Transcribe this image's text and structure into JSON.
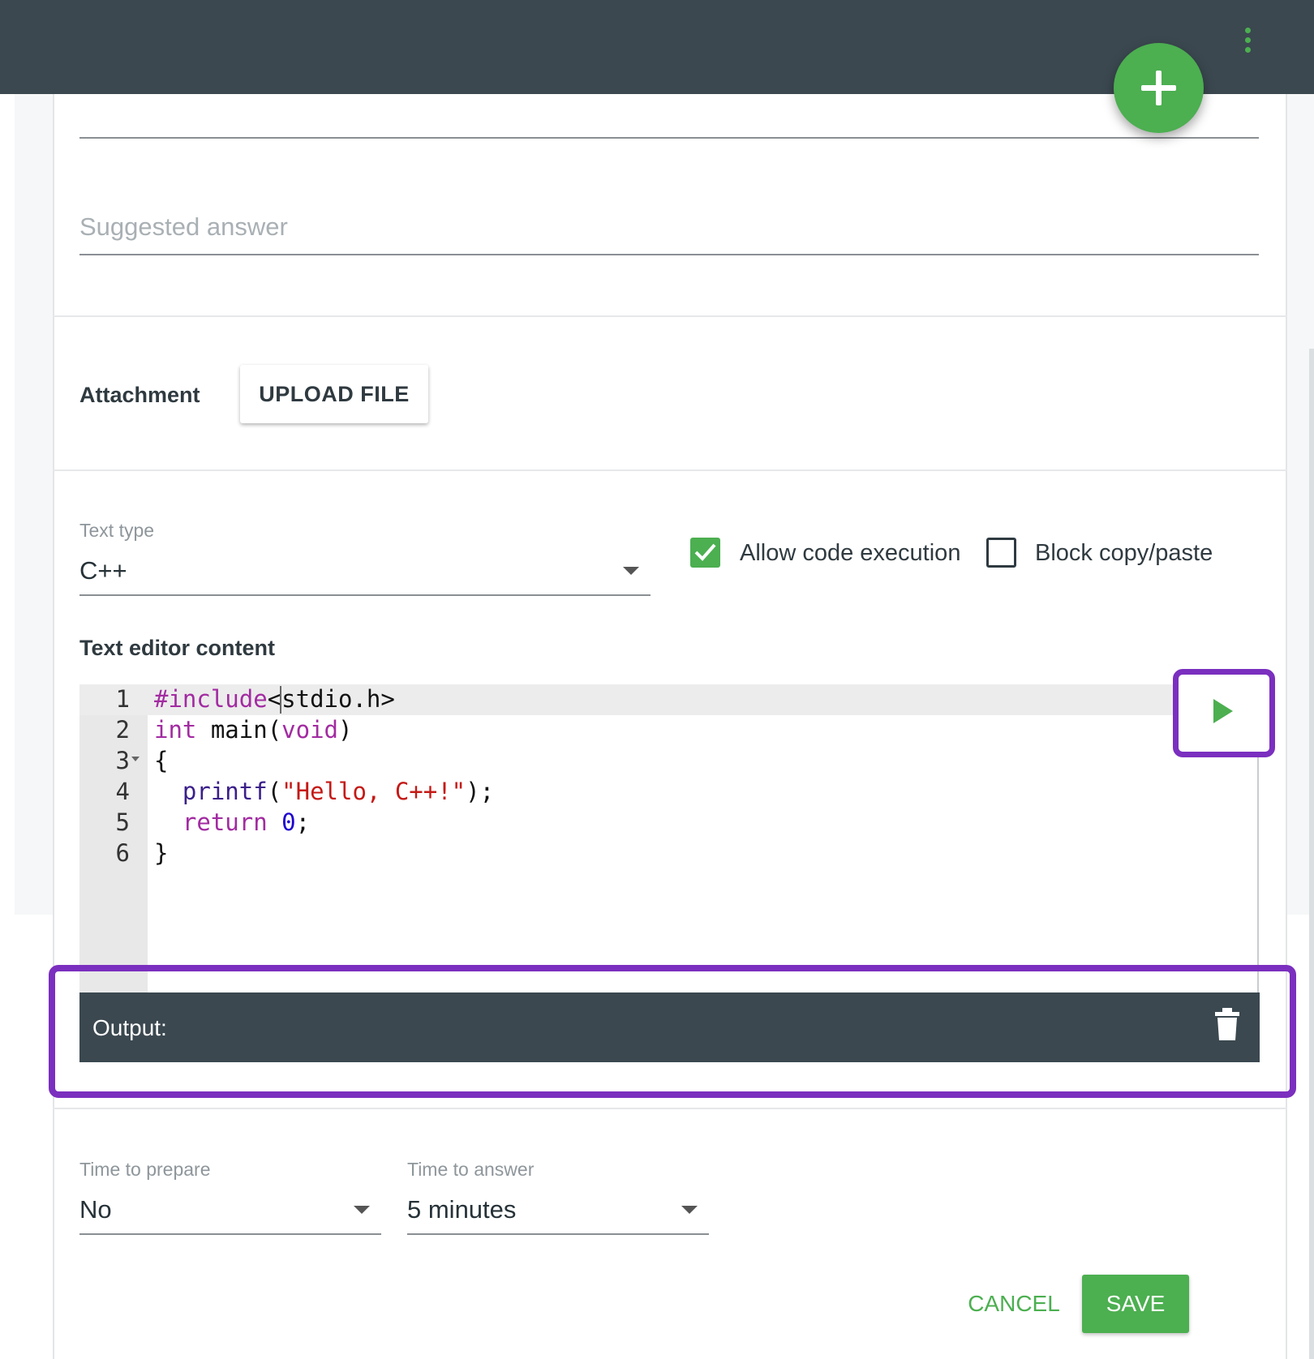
{
  "form": {
    "suggested_answer_placeholder": "Suggested answer",
    "attachment_label": "Attachment",
    "upload_button": "UPLOAD FILE"
  },
  "text_type": {
    "label": "Text type",
    "value": "C++"
  },
  "options": {
    "allow_code_execution": {
      "label": "Allow code execution",
      "checked": true
    },
    "block_copy_paste": {
      "label": "Block copy/paste",
      "checked": false
    }
  },
  "editor": {
    "title": "Text editor content",
    "line_numbers": [
      "1",
      "2",
      "3",
      "4",
      "5",
      "6"
    ],
    "lines": [
      "#include<stdio.h>",
      "int main(void)",
      "{",
      "  printf(\"Hello, C++!\");",
      "  return 0;",
      "}"
    ]
  },
  "output": {
    "label": "Output:"
  },
  "timing": {
    "prepare_label": "Time to prepare",
    "prepare_value": "No",
    "answer_label": "Time to answer",
    "answer_value": "5 minutes"
  },
  "actions": {
    "cancel": "CANCEL",
    "save": "SAVE"
  },
  "icons": {
    "fab": "plus-icon",
    "menu": "more-vertical-icon",
    "run": "play-icon",
    "clear": "trash-icon"
  },
  "colors": {
    "accent": "#4caf50",
    "topbar": "#3b4850",
    "highlight": "#7b2fbf"
  }
}
